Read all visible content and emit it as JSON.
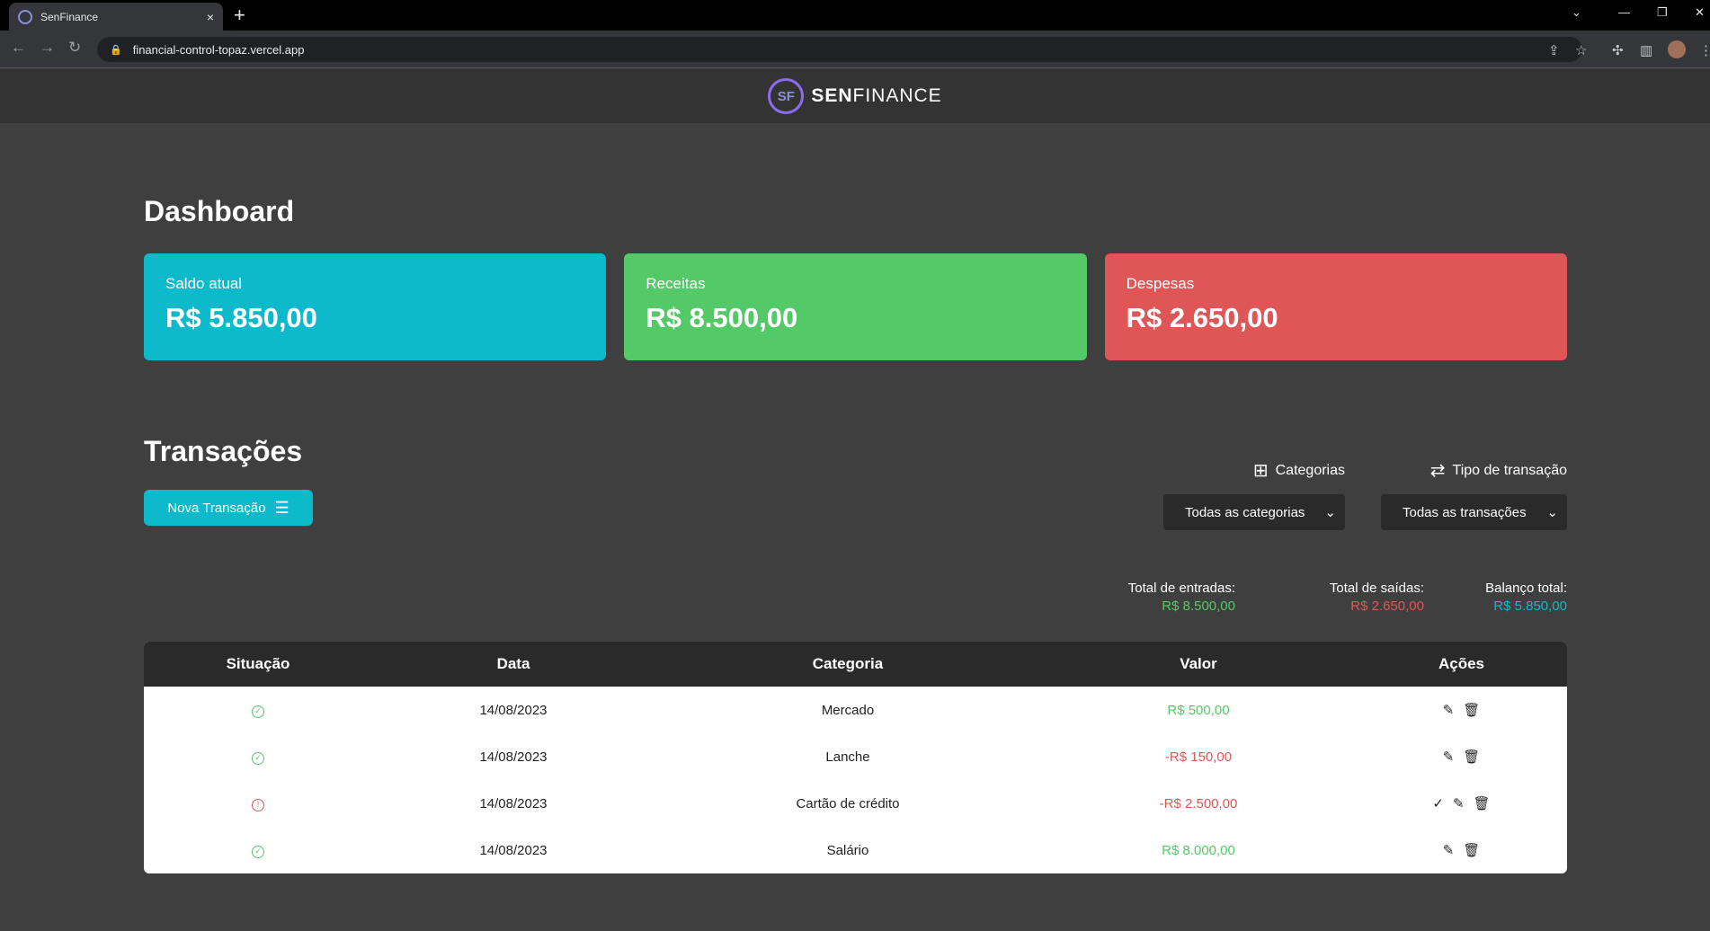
{
  "browser": {
    "tab_title": "SenFinance",
    "tab_close": "×",
    "new_tab": "+",
    "url": "financial-control-topaz.vercel.app"
  },
  "brand": {
    "mark": "SF",
    "bold": "SEN",
    "rest": "FINANCE"
  },
  "dashboard": {
    "title": "Dashboard",
    "cards": [
      {
        "label": "Saldo atual",
        "value": "R$ 5.850,00"
      },
      {
        "label": "Receitas",
        "value": "R$ 8.500,00"
      },
      {
        "label": "Despesas",
        "value": "R$ 2.650,00"
      }
    ]
  },
  "transactions": {
    "title": "Transações",
    "new_button": "Nova Transação",
    "filters": {
      "categories_label": "Categorias",
      "categories_value": "Todas as categorias",
      "type_label": "Tipo de transação",
      "type_value": "Todas as transações"
    },
    "totals": {
      "in_label": "Total de entradas:",
      "in_value": "R$ 8.500,00",
      "out_label": "Total de saídas:",
      "out_value": "R$ 2.650,00",
      "balance_label": "Balanço total:",
      "balance_value": "R$ 5.850,00"
    },
    "columns": [
      "Situação",
      "Data",
      "Categoria",
      "Valor",
      "Ações"
    ],
    "rows": [
      {
        "status": "ok",
        "date": "14/08/2023",
        "category": "Mercado",
        "value": "R$ 500,00",
        "kind": "in"
      },
      {
        "status": "ok",
        "date": "14/08/2023",
        "category": "Lanche",
        "value": "-R$ 150,00",
        "kind": "out"
      },
      {
        "status": "pending",
        "date": "14/08/2023",
        "category": "Cartão de crédito",
        "value": "-R$ 2.500,00",
        "kind": "out"
      },
      {
        "status": "ok",
        "date": "14/08/2023",
        "category": "Salário",
        "value": "R$ 8.000,00",
        "kind": "in"
      }
    ]
  },
  "colors": {
    "cyan": "#0dbacb",
    "green": "#54c968",
    "red": "#e05656"
  }
}
